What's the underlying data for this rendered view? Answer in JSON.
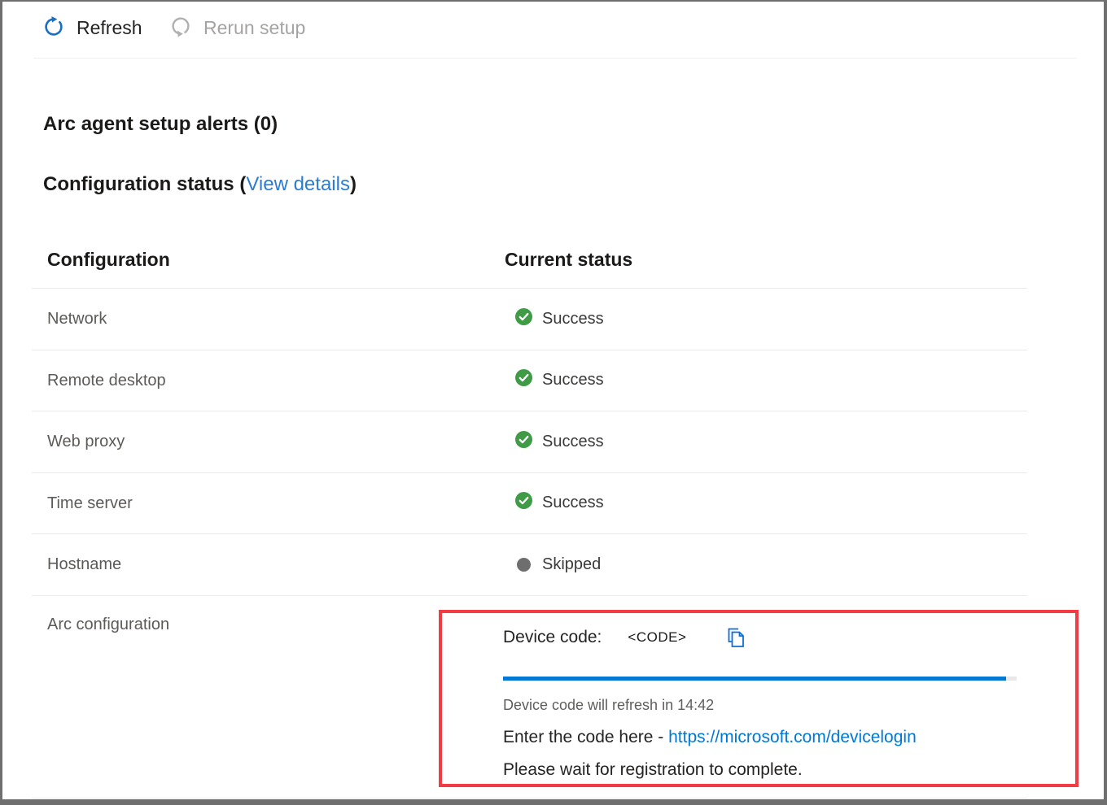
{
  "toolbar": {
    "refresh_label": "Refresh",
    "rerun_label": "Rerun setup"
  },
  "headings": {
    "alerts": "Arc agent setup alerts (0)",
    "config_prefix": "Configuration status (",
    "view_details": "View details",
    "config_suffix": ")"
  },
  "table": {
    "col_configuration": "Configuration",
    "col_status": "Current status",
    "rows": [
      {
        "label": "Network",
        "status": "Success"
      },
      {
        "label": "Remote desktop",
        "status": "Success"
      },
      {
        "label": "Web proxy",
        "status": "Success"
      },
      {
        "label": "Time server",
        "status": "Success"
      },
      {
        "label": "Hostname",
        "status": "Skipped"
      },
      {
        "label": "Arc configuration"
      }
    ]
  },
  "device_code": {
    "label": "Device code:",
    "code": "<CODE>",
    "refresh_countdown": "Device code will refresh in 14:42",
    "enter_prefix": "Enter the code here - ",
    "login_url": "https://microsoft.com/devicelogin",
    "wait_text": "Please wait for registration to complete.",
    "progress_percent": 98
  },
  "colors": {
    "accent_blue": "#0078d4",
    "success_green": "#3f9b46",
    "skipped_gray": "#6e6e6e",
    "highlight_red": "#f23b42"
  }
}
